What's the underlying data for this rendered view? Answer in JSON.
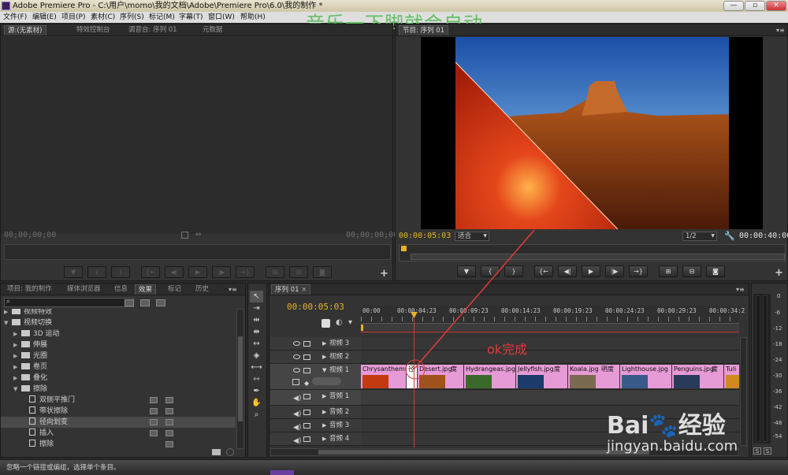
{
  "window": {
    "title": "Adobe Premiere Pro - C:\\用户\\momo\\我的文档\\Adobe\\Premiere Pro\\6.0\\我的制作 *",
    "min": "—",
    "max": "▫",
    "close": "✕"
  },
  "menu": [
    "文件(F)",
    "编辑(E)",
    "项目(P)",
    "素材(C)",
    "序列(S)",
    "标记(M)",
    "字幕(T)",
    "窗口(W)",
    "帮助(H)"
  ],
  "overlay_title": "音乐一下脚就会自动",
  "source_panel": {
    "tabs": [
      "源:(无素材)",
      "特效控制台",
      "调音台: 序列 01",
      "元数据"
    ],
    "tc_left": "00;00;00;00",
    "tc_right": "00;00;00;00"
  },
  "program_panel": {
    "tab": "节目: 序列 01",
    "tc_current": "00:00:05:03",
    "fit": "适合",
    "ratio": "1/2",
    "tc_duration": "00:00:40:00"
  },
  "project_panel": {
    "tabs": [
      "项目: 我的制作",
      "媒体浏览器",
      "信息",
      "效果",
      "标记",
      "历史"
    ],
    "tree": [
      {
        "type": "folder",
        "label": "视频特效",
        "indent": 0,
        "open": false
      },
      {
        "type": "folder",
        "label": "视频切换",
        "indent": 0,
        "open": true
      },
      {
        "type": "folder",
        "label": "3D 运动",
        "indent": 1,
        "open": false
      },
      {
        "type": "folder",
        "label": "伸展",
        "indent": 1,
        "open": false
      },
      {
        "type": "folder",
        "label": "光圈",
        "indent": 1,
        "open": false
      },
      {
        "type": "folder",
        "label": "卷页",
        "indent": 1,
        "open": false
      },
      {
        "type": "folder",
        "label": "叠化",
        "indent": 1,
        "open": false
      },
      {
        "type": "folder",
        "label": "擦除",
        "indent": 1,
        "open": true
      },
      {
        "type": "fx",
        "label": "双侧平推门",
        "indent": 2
      },
      {
        "type": "fx",
        "label": "带状擦除",
        "indent": 2
      },
      {
        "type": "fx",
        "label": "径向划变",
        "indent": 2
      },
      {
        "type": "fx",
        "label": "插入",
        "indent": 2
      },
      {
        "type": "fx",
        "label": "擦除",
        "indent": 2
      }
    ]
  },
  "timeline": {
    "tab": "序列 01",
    "tc": "00:00:05:03",
    "ruler": [
      "00:00",
      "00:00:04:23",
      "00:00:09:23",
      "00:00:14:23",
      "00:00:19:23",
      "00:00:24:23",
      "00:00:29:23",
      "00:00:34:2"
    ],
    "tracks": [
      {
        "kind": "video",
        "label": "视频 3"
      },
      {
        "kind": "video",
        "label": "视频 2"
      },
      {
        "kind": "video",
        "label": "视频 1"
      },
      {
        "kind": "audio",
        "label": "音频 1"
      },
      {
        "kind": "audio",
        "label": "音频 2"
      },
      {
        "kind": "audio",
        "label": "音频 3"
      },
      {
        "kind": "audio",
        "label": "音频 4"
      }
    ],
    "clips": [
      {
        "name": "Chrysanthemum",
        "color": "#c43a10"
      },
      {
        "name": "径",
        "color": "#ffffff"
      },
      {
        "name": "Desert.jpg",
        "color": "#a0521c"
      },
      {
        "name": "度",
        "color": "#e79bd6"
      },
      {
        "name": "Hydrangeas.jpg",
        "color": "#3a6a2a"
      },
      {
        "name": "Jellyfish.jpg",
        "color": "#1c3a6a"
      },
      {
        "name": "度",
        "color": "#e79bd6"
      },
      {
        "name": "Koala.jpg",
        "color": "#7a6a50"
      },
      {
        "name": "明度",
        "color": "#e79bd6"
      },
      {
        "name": "Lighthouse.jpg",
        "color": "#3a5a8a"
      },
      {
        "name": "Penguins.jpg",
        "color": "#2a3a5a"
      },
      {
        "name": "度",
        "color": "#e79bd6"
      },
      {
        "name": "Tuli",
        "color": "#d08a20"
      }
    ],
    "annotation": "ok完成"
  },
  "status_bar": "忽略一个链接或编组，选择单个条目。",
  "watermark": {
    "logo": "Bai🐾经验",
    "url": "jingyan.baidu.com"
  },
  "meter_labels": [
    "0",
    "-6",
    "-12",
    "-18",
    "-24",
    "-30",
    "-36",
    "-42",
    "-48",
    "-54"
  ],
  "meter_bottom": [
    "S",
    "S"
  ],
  "colors": {
    "accent_yellow": "#e6b32a",
    "clip_pink": "#e79bd6",
    "red_line": "#e23b3b"
  }
}
